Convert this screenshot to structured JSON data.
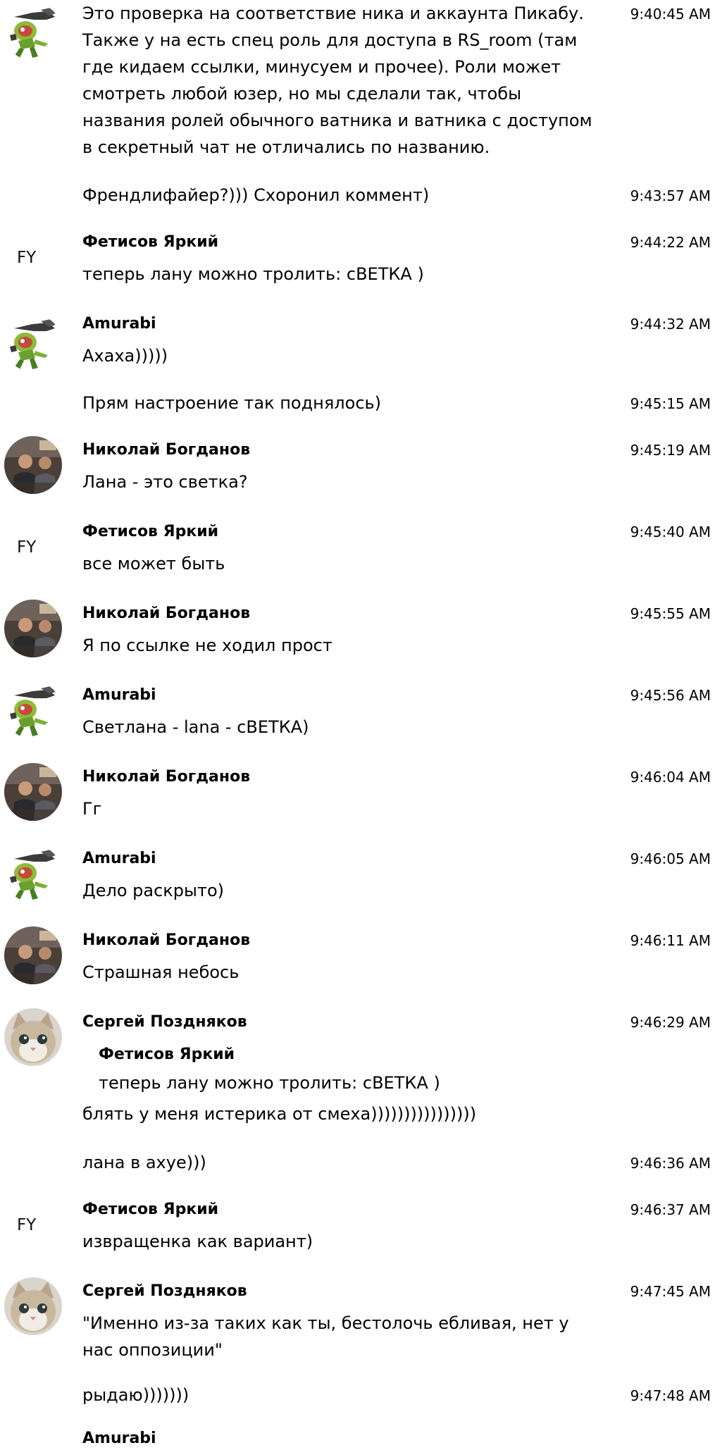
{
  "messages": [
    {
      "text": "Это проверка на соответствие ника и аккаунта Пикабу. Также у на есть спец роль для доступа в RS_room (там где кидаем ссылки, минусуем и прочее). Роли может смотреть любой юзер, но мы сделали так, чтобы названия ролей обычного ватника и ватника с доступом в секретный чат не отличались по названию.",
      "time": "9:40:45 AM",
      "avatar": "zombie-avatar"
    },
    {
      "text": "Френдлифайер?))) Схоронил коммент)",
      "time": "9:43:57 AM"
    },
    {
      "author": "Фетисов Яркий",
      "initials": "FY",
      "text": "теперь лану можно тролить: сВЕТКА )",
      "time": "9:44:22 AM"
    },
    {
      "author": "Amurabi",
      "text": "Ахаха)))))",
      "time": "9:44:32 AM",
      "avatar": "zombie-avatar"
    },
    {
      "text": "Прям настроение так поднялось)",
      "time": "9:45:15 AM"
    },
    {
      "author": "Николай Богданов",
      "text": "Лана - это светка?",
      "time": "9:45:19 AM",
      "avatar": "photo-avatar"
    },
    {
      "author": "Фетисов Яркий",
      "initials": "FY",
      "text": "все может быть",
      "time": "9:45:40 AM"
    },
    {
      "author": "Николай Богданов",
      "text": "Я по ссылке не ходил прост",
      "time": "9:45:55 AM",
      "avatar": "photo-avatar"
    },
    {
      "author": "Amurabi",
      "text": "Светлана - lana - сВЕТКА)",
      "time": "9:45:56 AM",
      "avatar": "zombie-avatar"
    },
    {
      "author": "Николай Богданов",
      "text": "Гг",
      "time": "9:46:04 AM",
      "avatar": "photo-avatar"
    },
    {
      "author": "Amurabi",
      "text": "Дело раскрыто)",
      "time": "9:46:05 AM",
      "avatar": "zombie-avatar"
    },
    {
      "author": "Николай Богданов",
      "text": "Страшная небось",
      "time": "9:46:11 AM",
      "avatar": "photo-avatar"
    },
    {
      "author": "Сергей Поздняков",
      "quote": {
        "author": "Фетисов Яркий",
        "text": "теперь лану можно тролить: сВЕТКА )"
      },
      "text": "блять у меня истерика от смеха))))))))))))))))",
      "time": "9:46:29 AM",
      "avatar": "cat-avatar"
    },
    {
      "text": "лана в ахуе)))",
      "time": "9:46:36 AM"
    },
    {
      "author": "Фетисов Яркий",
      "initials": "FY",
      "text": "извращенка как вариант)",
      "time": "9:46:37 AM"
    },
    {
      "author": "Сергей Поздняков",
      "text": "\"Именно из-за таких как ты, бестолочь ебливая, нет у нас оппозиции\"",
      "time": "9:47:45 AM",
      "avatar": "cat-avatar"
    },
    {
      "text": "рыдаю)))))))",
      "time": "9:47:48 AM"
    },
    {
      "author": "Amurabi"
    }
  ]
}
